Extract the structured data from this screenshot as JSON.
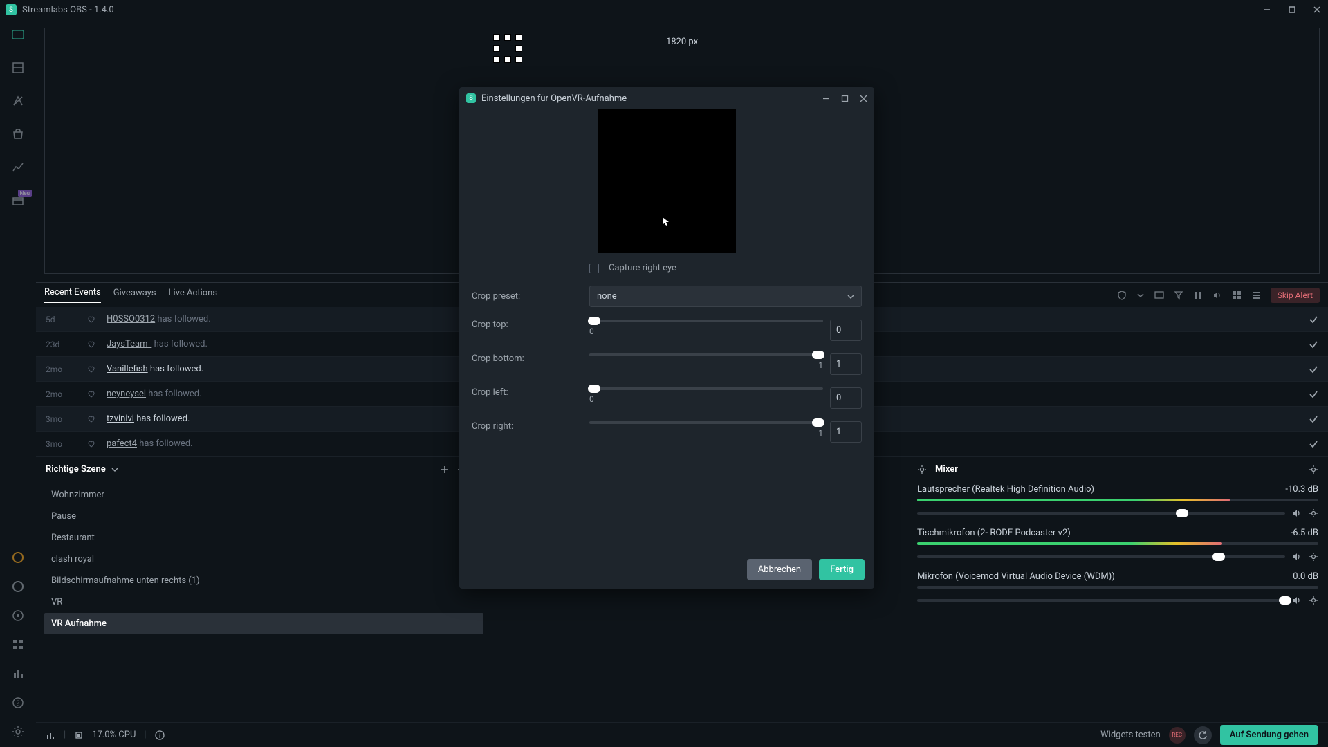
{
  "app": {
    "title": "Streamlabs OBS - 1.4.0"
  },
  "preview": {
    "px_label": "1820 px"
  },
  "event_tabs": {
    "recent": "Recent Events",
    "giveaways": "Giveaways",
    "live_actions": "Live Actions"
  },
  "skip_alert": "Skip Alert",
  "events": [
    {
      "time": "5d",
      "user": "H0SSO0312",
      "text": "has followed.",
      "hl": false
    },
    {
      "time": "23d",
      "user": "JaysTeam_",
      "text": "has followed.",
      "hl": false
    },
    {
      "time": "2mo",
      "user": "Vanillefish",
      "text": "has followed.",
      "hl": true
    },
    {
      "time": "2mo",
      "user": "neyneysel",
      "text": "has followed.",
      "hl": false
    },
    {
      "time": "3mo",
      "user": "tzvinivi",
      "text": "has followed.",
      "hl": true
    },
    {
      "time": "3mo",
      "user": "pafect4",
      "text": "has followed.",
      "hl": false
    }
  ],
  "scenes": {
    "title": "Richtige Szene",
    "items": [
      "Wohnzimmer",
      "Pause",
      "Restaurant",
      "clash royal",
      "Bildschirmaufnahme unten rechts (1)",
      "VR",
      "VR Aufnahme"
    ],
    "selected": 6
  },
  "mixer": {
    "title": "Mixer",
    "tracks": [
      {
        "name": "Lautsprecher (Realtek High Definition Audio)",
        "db": "-10.3 dB",
        "meter_pct": 78,
        "vol_pct": 72
      },
      {
        "name": "Tischmikrofon (2- RODE Podcaster v2)",
        "db": "-6.5 dB",
        "meter_pct": 76,
        "vol_pct": 82
      },
      {
        "name": "Mikrofon (Voicemod Virtual Audio Device (WDM))",
        "db": "0.0 dB",
        "meter_pct": 0,
        "vol_pct": 100
      }
    ]
  },
  "footer": {
    "cpu": "17.0% CPU",
    "widgets": "Widgets testen",
    "rec": "REC",
    "go_live": "Auf Sendung gehen"
  },
  "modal": {
    "title": "Einstellungen für OpenVR-Aufnahme",
    "capture_right_eye": "Capture right eye",
    "crop_preset_label": "Crop preset:",
    "crop_preset_value": "none",
    "crop_top_label": "Crop top:",
    "crop_top_value": "0",
    "crop_top_below": "0",
    "crop_bottom_label": "Crop bottom:",
    "crop_bottom_value": "1",
    "crop_bottom_below": "1",
    "crop_left_label": "Crop left:",
    "crop_left_value": "0",
    "crop_left_below": "0",
    "crop_right_label": "Crop right:",
    "crop_right_value": "1",
    "crop_right_below": "1",
    "cancel": "Abbrechen",
    "done": "Fertig"
  },
  "rail_badge": "Neu"
}
